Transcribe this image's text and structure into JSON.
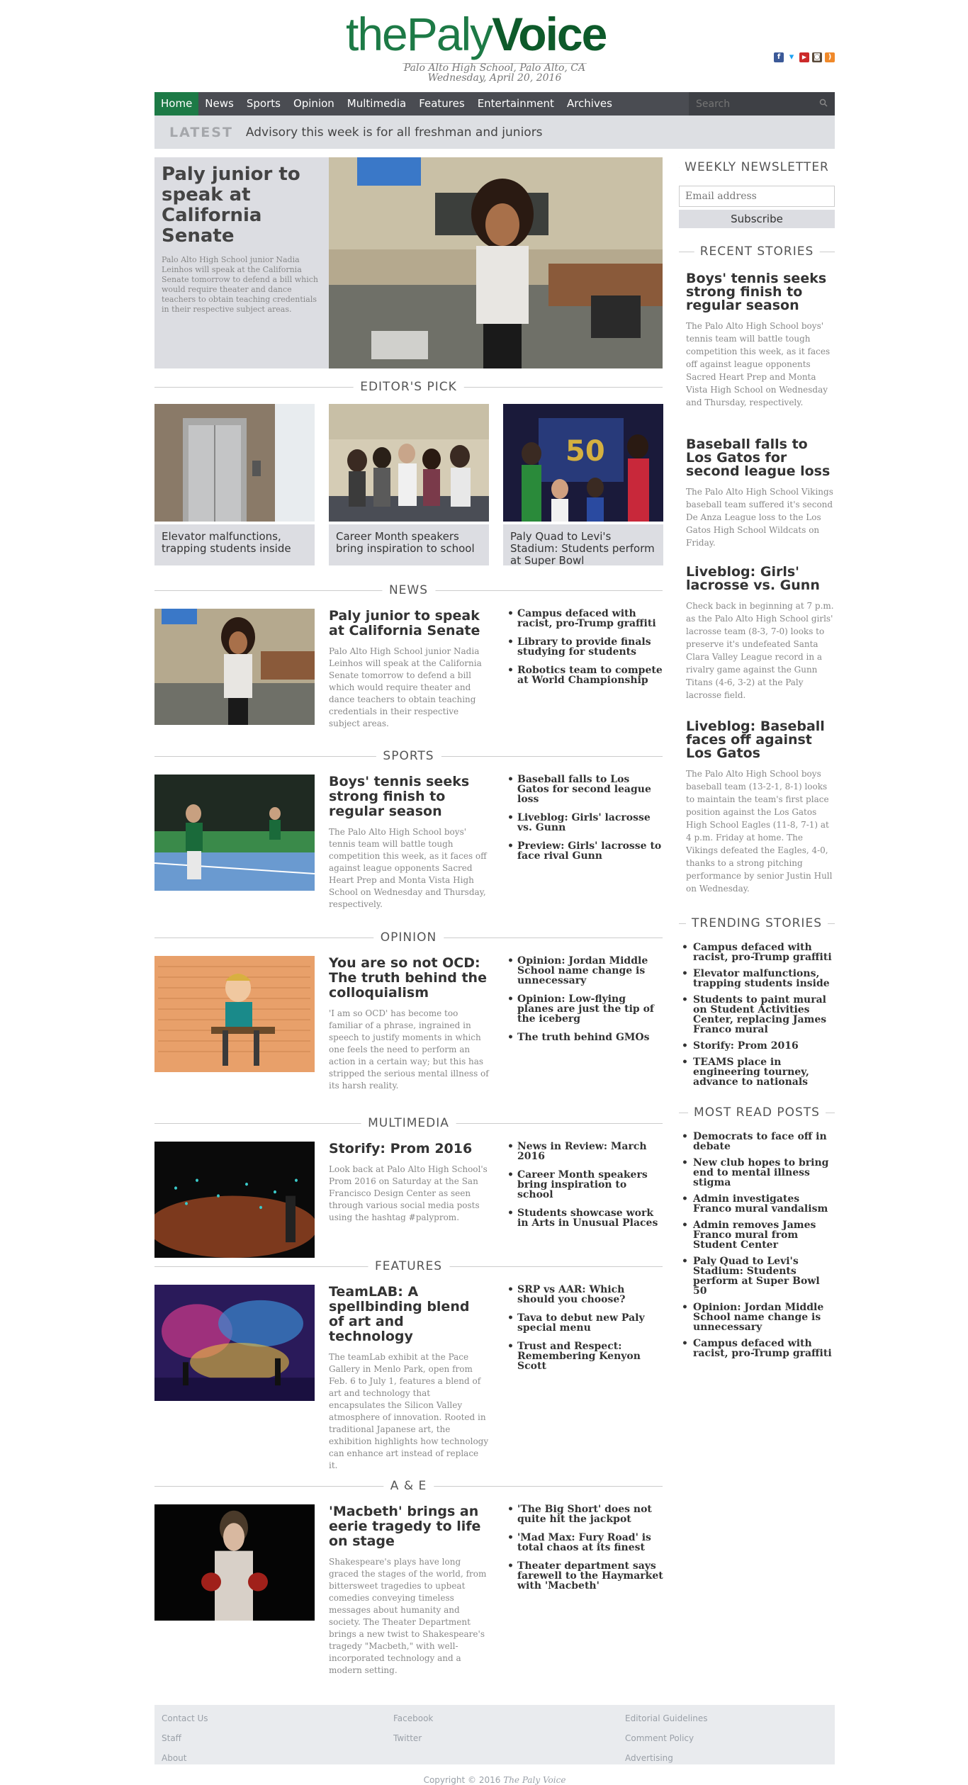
{
  "header": {
    "logo_the": "the",
    "logo_paly": "Paly",
    "logo_voice": "Voice",
    "tagline": "Palo Alto High School, Palo Alto, CA",
    "date": "Wednesday, April 20, 2016"
  },
  "social": [
    "facebook-icon",
    "twitter-icon",
    "youtube-icon",
    "instagram-icon",
    "rss-icon"
  ],
  "nav": {
    "items": [
      "Home",
      "News",
      "Sports",
      "Opinion",
      "Multimedia",
      "Features",
      "Entertainment",
      "Archives"
    ],
    "search_placeholder": "Search"
  },
  "latest": {
    "label": "LATEST",
    "text": "Advisory this week is for all freshman and juniors"
  },
  "hero": {
    "title": "Paly junior to speak at California Senate",
    "summary": "Palo Alto High School junior Nadia Leinhos will speak at the California Senate tomorrow to defend a bill which would require theater and dance teachers to obtain teaching credentials in their respective subject areas."
  },
  "editors_pick": {
    "heading": "EDITOR'S PICK",
    "items": [
      "Elevator malfunctions, trapping students inside",
      "Career Month speakers bring inspiration to school",
      "Paly Quad to Levi's Stadium: Students perform at Super Bowl"
    ]
  },
  "sections": [
    {
      "heading": "NEWS",
      "title": "Paly junior to speak at California Senate",
      "summary": "Palo Alto High School junior Nadia Leinhos will speak at the California Senate tomorrow to defend a bill which would require theater and dance teachers to obtain teaching credentials in their respective subject areas.",
      "links": [
        "Campus defaced with racist, pro-Trump graffiti",
        "Library to provide finals studying for students",
        "Robotics team to compete at World Championship"
      ]
    },
    {
      "heading": "SPORTS",
      "title": "Boys' tennis seeks strong finish to regular season",
      "summary": "The Palo Alto High School boys' tennis team will battle tough competition this week, as it faces off against league opponents Sacred Heart Prep and Monta Vista High School on Wednesday and Thursday, respectively.",
      "links": [
        "Baseball falls to Los Gatos for second league loss",
        "Liveblog: Girls' lacrosse vs. Gunn",
        "Preview: Girls' lacrosse to face rival Gunn"
      ]
    },
    {
      "heading": "OPINION",
      "title": "You are so not OCD: The truth behind the colloquialism",
      "summary": "'I am so OCD' has become too familiar of a phrase, ingrained in speech to justify moments in which one feels the need to perform an action in a certain way; but this has stripped the serious mental illness of its harsh reality.",
      "links": [
        "Opinion: Jordan Middle School name change is unnecessary",
        "Opinion: Low-flying planes are just the tip of the iceberg",
        "The truth behind GMOs"
      ]
    },
    {
      "heading": "MULTIMEDIA",
      "title": "Storify: Prom 2016",
      "summary": "Look back at Palo Alto High School's Prom 2016 on Saturday at the San Francisco Design Center as seen through various social media posts using the hashtag #palyprom.",
      "links": [
        "News in Review: March 2016",
        "Career Month speakers bring inspiration to school",
        "Students showcase work in Arts in Unusual Places"
      ]
    },
    {
      "heading": "FEATURES",
      "title": "TeamLAB: A spellbinding blend of art and technology",
      "summary": "The teamLab exhibit at the Pace Gallery in Menlo Park, open from Feb. 6 to July 1, features a blend of art and technology that encapsulates the Silicon Valley atmosphere of innovation. Rooted in traditional Japanese art, the exhibition highlights how technology can enhance art instead of replace it.",
      "links": [
        "SRP vs AAR: Which should you choose?",
        "Tava to debut new Paly special menu",
        "Trust and Respect: Remembering Kenyon Scott"
      ]
    },
    {
      "heading": "A & E",
      "title": "'Macbeth' brings an eerie tragedy to life on stage",
      "summary": "Shakespeare's plays have long graced the stages of the world, from bittersweet tragedies to upbeat comedies conveying timeless messages about humanity and society. The Theater Department brings a new twist to Shakespeare's tragedy \"Macbeth,\" with well-incorporated technology and a modern setting.",
      "links": [
        "'The Big Short' does not quite hit the jackpot",
        "'Mad Max: Fury Road' is total chaos at its finest",
        "Theater department says farewell to the Haymarket with 'Macbeth'"
      ]
    }
  ],
  "sidebar": {
    "newsletter_heading": "WEEKLY NEWSLETTER",
    "email_placeholder": "Email address",
    "subscribe_label": "Subscribe",
    "recent_heading": "RECENT STORIES",
    "recent": [
      {
        "title": "Boys' tennis seeks strong finish to regular season",
        "summary": "The Palo Alto High School boys' tennis team will battle tough competition this week, as it faces off against league opponents Sacred Heart Prep and Monta Vista High School on Wednesday and Thursday, respectively."
      },
      {
        "title": "Baseball falls to Los Gatos for second league loss",
        "summary": "The Palo Alto High School Vikings baseball team suffered it's second De Anza League loss to the Los Gatos High School Wildcats on Friday."
      },
      {
        "title": "Liveblog: Girls' lacrosse vs. Gunn",
        "summary": "Check back in beginning at 7 p.m. as the Palo Alto High School girls' lacrosse team (8-3, 7-0) looks to preserve it's undefeated Santa Clara Valley League record in a rivalry game against the Gunn Titans (4-6, 3-2) at the Paly lacrosse field."
      },
      {
        "title": "Liveblog: Baseball faces off against Los Gatos",
        "summary": "The Palo Alto High School boys baseball team (13-2-1, 8-1) looks to maintain the team's first place position against the Los Gatos High School Eagles (11-8, 7-1) at 4 p.m. Friday at home. The Vikings defeated the Eagles, 4-0, thanks to a strong pitching performance by senior Justin Hull on Wednesday."
      }
    ],
    "trending_heading": "TRENDING STORIES",
    "trending": [
      "Campus defaced with racist, pro-Trump graffiti",
      "Elevator malfunctions, trapping students inside",
      "Students to paint mural on Student Activities Center, replacing James Franco mural",
      "Storify: Prom 2016",
      "TEAMS place in engineering tourney, advance to nationals"
    ],
    "mostread_heading": "MOST READ POSTS",
    "mostread": [
      "Democrats to face off in debate",
      "New club hopes to bring end to mental illness stigma",
      "Admin investigates Franco mural vandalism",
      "Admin removes James Franco mural from Student Center",
      "Paly Quad to Levi's Stadium: Students perform at Super Bowl 50",
      "Opinion: Jordan Middle School name change is unnecessary",
      "Campus defaced with racist, pro-Trump graffiti"
    ]
  },
  "footer": {
    "links": [
      "Contact Us",
      "Staff",
      "About",
      "Facebook",
      "Twitter",
      "Editorial Guidelines",
      "Comment Policy",
      "Advertising"
    ],
    "copyright": "Copyright © 2016",
    "copyright_brand": "The Paly Voice"
  },
  "colors": {
    "brand_green": "#1d7a46",
    "nav_bg": "#4a4c52",
    "panel_gray": "#dcdde2"
  }
}
